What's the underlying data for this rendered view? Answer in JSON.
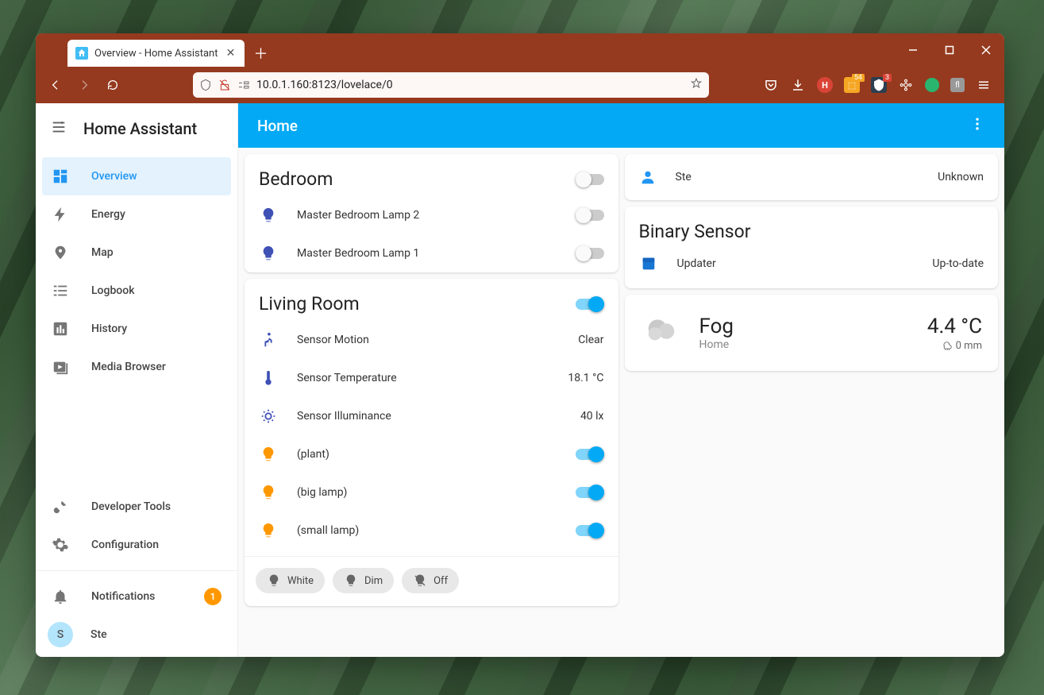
{
  "browser": {
    "tab_title": "Overview - Home Assistant",
    "url_display": "10.0.1.160:8123/lovelace/0"
  },
  "sidebar": {
    "title": "Home Assistant",
    "items": [
      {
        "label": "Overview"
      },
      {
        "label": "Energy"
      },
      {
        "label": "Map"
      },
      {
        "label": "Logbook"
      },
      {
        "label": "History"
      },
      {
        "label": "Media Browser"
      }
    ],
    "dev_label": "Developer Tools",
    "config_label": "Configuration",
    "notifications_label": "Notifications",
    "notifications_count": "1",
    "user_initial": "S",
    "user_name": "Ste"
  },
  "topbar": {
    "title": "Home"
  },
  "bedroom": {
    "title": "Bedroom",
    "rows": [
      {
        "label": "Master Bedroom Lamp 2"
      },
      {
        "label": "Master Bedroom Lamp 1"
      }
    ]
  },
  "living": {
    "title": "Living Room",
    "rows": [
      {
        "label": "Sensor Motion",
        "value": "Clear"
      },
      {
        "label": "Sensor Temperature",
        "value": "18.1 °C"
      },
      {
        "label": "Sensor Illuminance",
        "value": "40 lx"
      },
      {
        "label": "(plant)"
      },
      {
        "label": "(big lamp)"
      },
      {
        "label": "(small lamp)"
      }
    ],
    "chips": [
      {
        "label": "White"
      },
      {
        "label": "Dim"
      },
      {
        "label": "Off"
      }
    ]
  },
  "person": {
    "name": "Ste",
    "state": "Unknown"
  },
  "binary": {
    "title": "Binary Sensor",
    "row_label": "Updater",
    "row_value": "Up-to-date"
  },
  "weather": {
    "condition": "Fog",
    "location": "Home",
    "temp": "4.4 °C",
    "precip": "0 mm"
  }
}
